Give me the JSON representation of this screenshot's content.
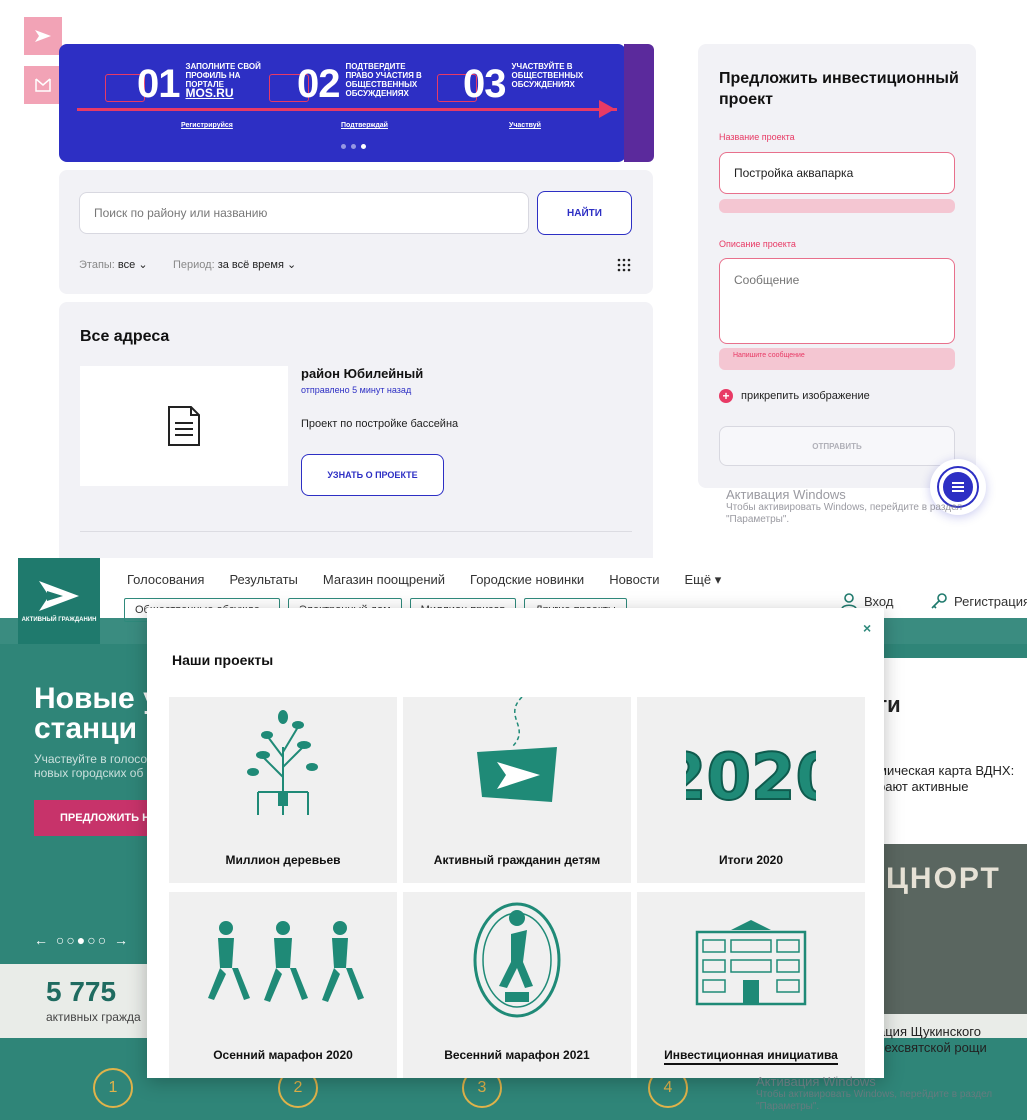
{
  "top": {
    "banner": {
      "steps": [
        {
          "num": "01",
          "text": "Заполните свой профиль на портале",
          "big": "mos.ru",
          "link": "Регистрируйся"
        },
        {
          "num": "02",
          "text": "Подтвердите право участия в общественных обсуждениях",
          "link": "Подтверждай"
        },
        {
          "num": "03",
          "text": "Участвуйте в общественных обсуждениях",
          "link": "Участвуй"
        }
      ]
    },
    "search": {
      "placeholder": "Поиск по району или названию",
      "button": "НАЙТИ"
    },
    "filters": {
      "stages_label": "Этапы:",
      "stages_value": "все",
      "period_label": "Период:",
      "period_value": "за всё время"
    },
    "addresses": {
      "title": "Все адреса",
      "item": {
        "name": "район Юбилейный",
        "time": "отправлено 5 минут назад",
        "desc": "Проект по постройке бассейна",
        "button": "УЗНАТЬ О ПРОЕКТЕ"
      }
    },
    "form": {
      "title": "Предложить инвестиционный проект",
      "name_label": "Название проекта",
      "name_value": "Постройка аквапарка",
      "desc_label": "Описание проекта",
      "desc_placeholder": "Сообщение",
      "desc_error": "Напишите сообщение",
      "attach": "прикрепить изображение",
      "submit": "ОТПРАВИТЬ"
    },
    "watermark": {
      "title": "Активация Windows",
      "line1": "Чтобы активировать Windows, перейдите в раздел",
      "line2": "\"Параметры\"."
    }
  },
  "bottom": {
    "logo_text": "АКТИВНЫЙ ГРАЖДАНИН",
    "nav": [
      "Голосования",
      "Результаты",
      "Магазин поощрений",
      "Городские новинки",
      "Новости",
      "Ещё ▾"
    ],
    "sub_nav": [
      "Общественные обсужде...",
      "Электронный дом",
      "Миллион призов",
      "Другие проекты"
    ],
    "login": "Вход",
    "register": "Регистрация",
    "hero": {
      "title_l1": "Новые у",
      "title_l2": "станци",
      "sub": "Участвуйте в голосо новых городских об",
      "button": "ПРЕДЛОЖИТЬ Н",
      "arrows": "← ○○●○○ →"
    },
    "stats": {
      "num": "5 775",
      "label": "активных гражда"
    },
    "right": {
      "heading": "ги",
      "news1": "мическая карта ВДНХ: рают активные",
      "img_text": "ЦНОРТ",
      "news2": "ация Щукинского сехсвятской рощи"
    },
    "steps": [
      "1",
      "2",
      "3",
      "4"
    ],
    "modal": {
      "title": "Наши проекты",
      "close": "×",
      "projects": [
        "Миллион деревьев",
        "Активный гражданин детям",
        "Итоги 2020",
        "Осенний марафон 2020",
        "Весенний марафон 2021",
        "Инвестиционная инициатива"
      ]
    },
    "watermark": {
      "title": "Активация Windows",
      "line1": "Чтобы активировать Windows, перейдите в раздел",
      "line2": "\"Параметры\"."
    }
  },
  "colors": {
    "blue": "#2d2fc4",
    "pink": "#e83a65",
    "green": "#1f7a6d",
    "teal_icon": "#1f8a77"
  }
}
